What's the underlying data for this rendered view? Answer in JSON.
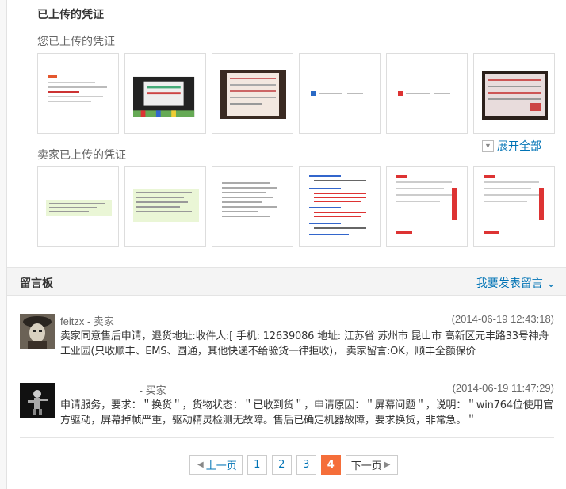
{
  "upload": {
    "title": "已上传的凭证",
    "mine_label": "您已上传的凭证",
    "seller_label": "卖家已上传的凭证",
    "expand_label": "展开全部"
  },
  "board": {
    "title": "留言板",
    "post_label": "我要发表留言",
    "messages": [
      {
        "name": "feitzx",
        "role": "- 卖家",
        "time": "(2014-06-19 12:43:18)",
        "content": "卖家同意售后申请，退货地址:收件人:[   手机:      12639086 地址: 江苏省 苏州市 昆山市 高新区元丰路33号神舟工业园(只收顺丰、EMS、圆通，其他快递不给验货一律拒收)，  卖家留言:OK，顺丰全额保价"
      },
      {
        "name": "",
        "role": "- 买家",
        "time": "(2014-06-19 11:47:29)",
        "content": "申请服务，要求：＂换货＂，货物状态：＂已收到货＂，申请原因：＂屏幕问题＂，说明：＂win764位使用官方驱动，屏幕掉帧严重，驱动精灵检测无故障。售后已确定机器故障，要求换货，非常急。＂"
      }
    ]
  },
  "pager": {
    "prev": "上一页",
    "pages": [
      "1",
      "2",
      "3",
      "4"
    ],
    "current": "4",
    "next": "下一页"
  }
}
